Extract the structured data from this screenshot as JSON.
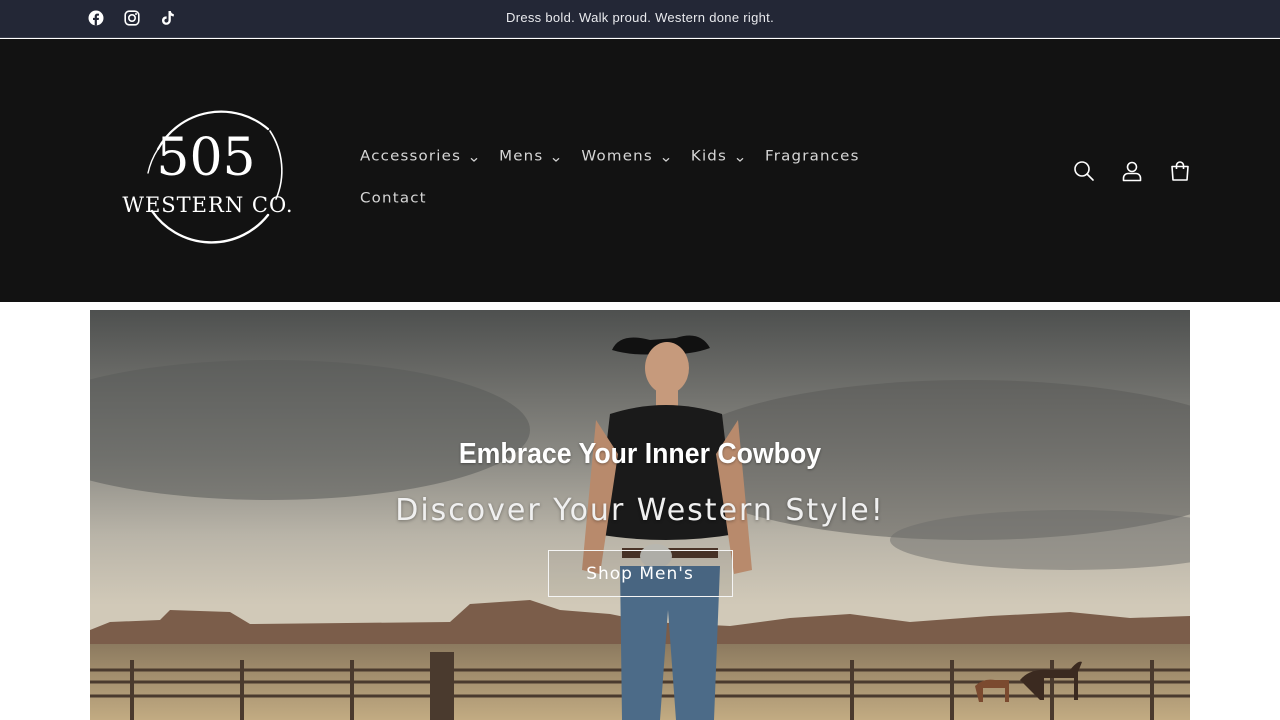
{
  "announcement": {
    "text": "Dress bold. Walk proud. Western done right."
  },
  "social": [
    {
      "icon": "facebook-icon"
    },
    {
      "icon": "instagram-icon"
    },
    {
      "icon": "tiktok-icon"
    }
  ],
  "logo": {
    "line1": "505",
    "line2": "WESTERN CO."
  },
  "nav": {
    "items": [
      {
        "label": "Accessories",
        "has_dropdown": true
      },
      {
        "label": "Mens",
        "has_dropdown": true
      },
      {
        "label": "Womens",
        "has_dropdown": true
      },
      {
        "label": "Kids",
        "has_dropdown": true
      },
      {
        "label": "Fragrances",
        "has_dropdown": false
      },
      {
        "label": "Contact",
        "has_dropdown": false
      }
    ]
  },
  "header_icons": [
    {
      "icon": "search-icon"
    },
    {
      "icon": "account-icon"
    },
    {
      "icon": "cart-icon"
    }
  ],
  "hero": {
    "title": "Embrace Your Inner Cowboy",
    "subtitle": "Discover Your Western Style!",
    "button_label": "Shop Men's"
  },
  "colors": {
    "announcement_bg": "#232736",
    "header_bg": "#121212",
    "text_light": "#d6d6d6"
  }
}
